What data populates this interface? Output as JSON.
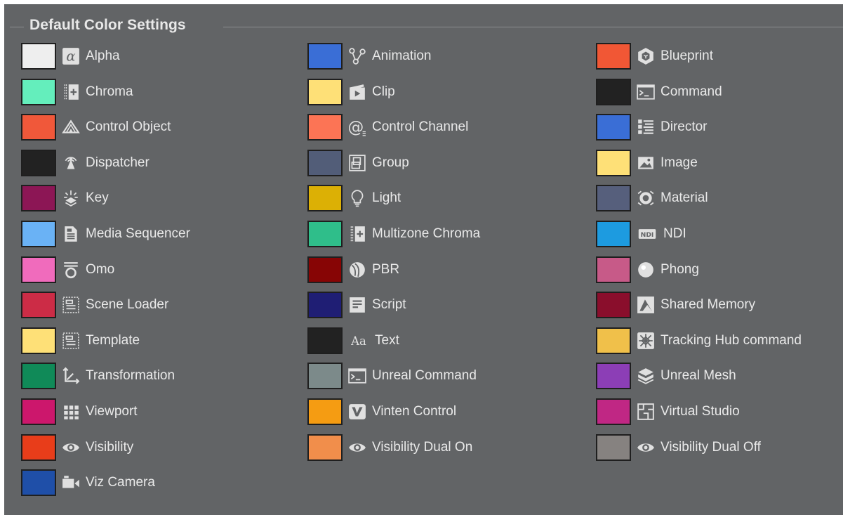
{
  "section": {
    "title": "Default Color Settings"
  },
  "columns": [
    [
      {
        "label": "Alpha",
        "color": "#eeeeee",
        "icon": "alpha-icon"
      },
      {
        "label": "Chroma",
        "color": "#64eebc",
        "icon": "chroma-icon"
      },
      {
        "label": "Control Object",
        "color": "#f0583a",
        "icon": "control-object-icon"
      },
      {
        "label": "Dispatcher",
        "color": "#222222",
        "icon": "dispatcher-icon"
      },
      {
        "label": "Key",
        "color": "#8c1655",
        "icon": "key-icon"
      },
      {
        "label": "Media Sequencer",
        "color": "#6ab2f5",
        "icon": "media-sequencer-icon"
      },
      {
        "label": "Omo",
        "color": "#f06bbc",
        "icon": "omo-icon"
      },
      {
        "label": "Scene Loader",
        "color": "#cc2c46",
        "icon": "scene-loader-icon"
      },
      {
        "label": "Template",
        "color": "#fee077",
        "icon": "template-icon"
      },
      {
        "label": "Transformation",
        "color": "#108a58",
        "icon": "transformation-icon"
      },
      {
        "label": "Viewport",
        "color": "#cc176c",
        "icon": "viewport-icon"
      },
      {
        "label": "Visibility",
        "color": "#e83d1a",
        "icon": "visibility-icon"
      },
      {
        "label": "Viz Camera",
        "color": "#1f4fa8",
        "icon": "viz-camera-icon"
      }
    ],
    [
      {
        "label": "Animation",
        "color": "#3a6ed6",
        "icon": "animation-icon"
      },
      {
        "label": "Clip",
        "color": "#fee077",
        "icon": "clip-icon"
      },
      {
        "label": "Control Channel",
        "color": "#fc7455",
        "icon": "control-channel-icon"
      },
      {
        "label": "Group",
        "color": "#525d78",
        "icon": "group-icon"
      },
      {
        "label": "Light",
        "color": "#dcb005",
        "icon": "light-icon"
      },
      {
        "label": "Multizone Chroma",
        "color": "#2fbe8a",
        "icon": "multizone-chroma-icon"
      },
      {
        "label": "PBR",
        "color": "#870505",
        "icon": "pbr-icon"
      },
      {
        "label": "Script",
        "color": "#1f1e74",
        "icon": "script-icon"
      },
      {
        "label": "Text",
        "color": "#222222",
        "icon": "text-icon"
      },
      {
        "label": "Unreal Command",
        "color": "#7c8a8a",
        "icon": "unreal-command-icon"
      },
      {
        "label": "Vinten Control",
        "color": "#f59c12",
        "icon": "vinten-control-icon"
      },
      {
        "label": "Visibility Dual On",
        "color": "#f18e4b",
        "icon": "visibility-dual-on-icon"
      }
    ],
    [
      {
        "label": "Blueprint",
        "color": "#f15735",
        "icon": "blueprint-icon"
      },
      {
        "label": "Command",
        "color": "#222222",
        "icon": "command-icon"
      },
      {
        "label": "Director",
        "color": "#3a6ed6",
        "icon": "director-icon"
      },
      {
        "label": "Image",
        "color": "#fee077",
        "icon": "image-icon"
      },
      {
        "label": "Material",
        "color": "#565f7c",
        "icon": "material-icon"
      },
      {
        "label": "NDI",
        "color": "#1d9be0",
        "icon": "ndi-icon"
      },
      {
        "label": "Phong",
        "color": "#c75a88",
        "icon": "phong-icon"
      },
      {
        "label": "Shared Memory",
        "color": "#8a0e2c",
        "icon": "shared-memory-icon"
      },
      {
        "label": "Tracking Hub command",
        "color": "#f0c04a",
        "icon": "tracking-hub-command-icon"
      },
      {
        "label": "Unreal Mesh",
        "color": "#8c3eb6",
        "icon": "unreal-mesh-icon"
      },
      {
        "label": "Virtual Studio",
        "color": "#c02784",
        "icon": "virtual-studio-icon"
      },
      {
        "label": "Visibility Dual Off",
        "color": "#868280",
        "icon": "visibility-dual-off-icon"
      }
    ]
  ]
}
